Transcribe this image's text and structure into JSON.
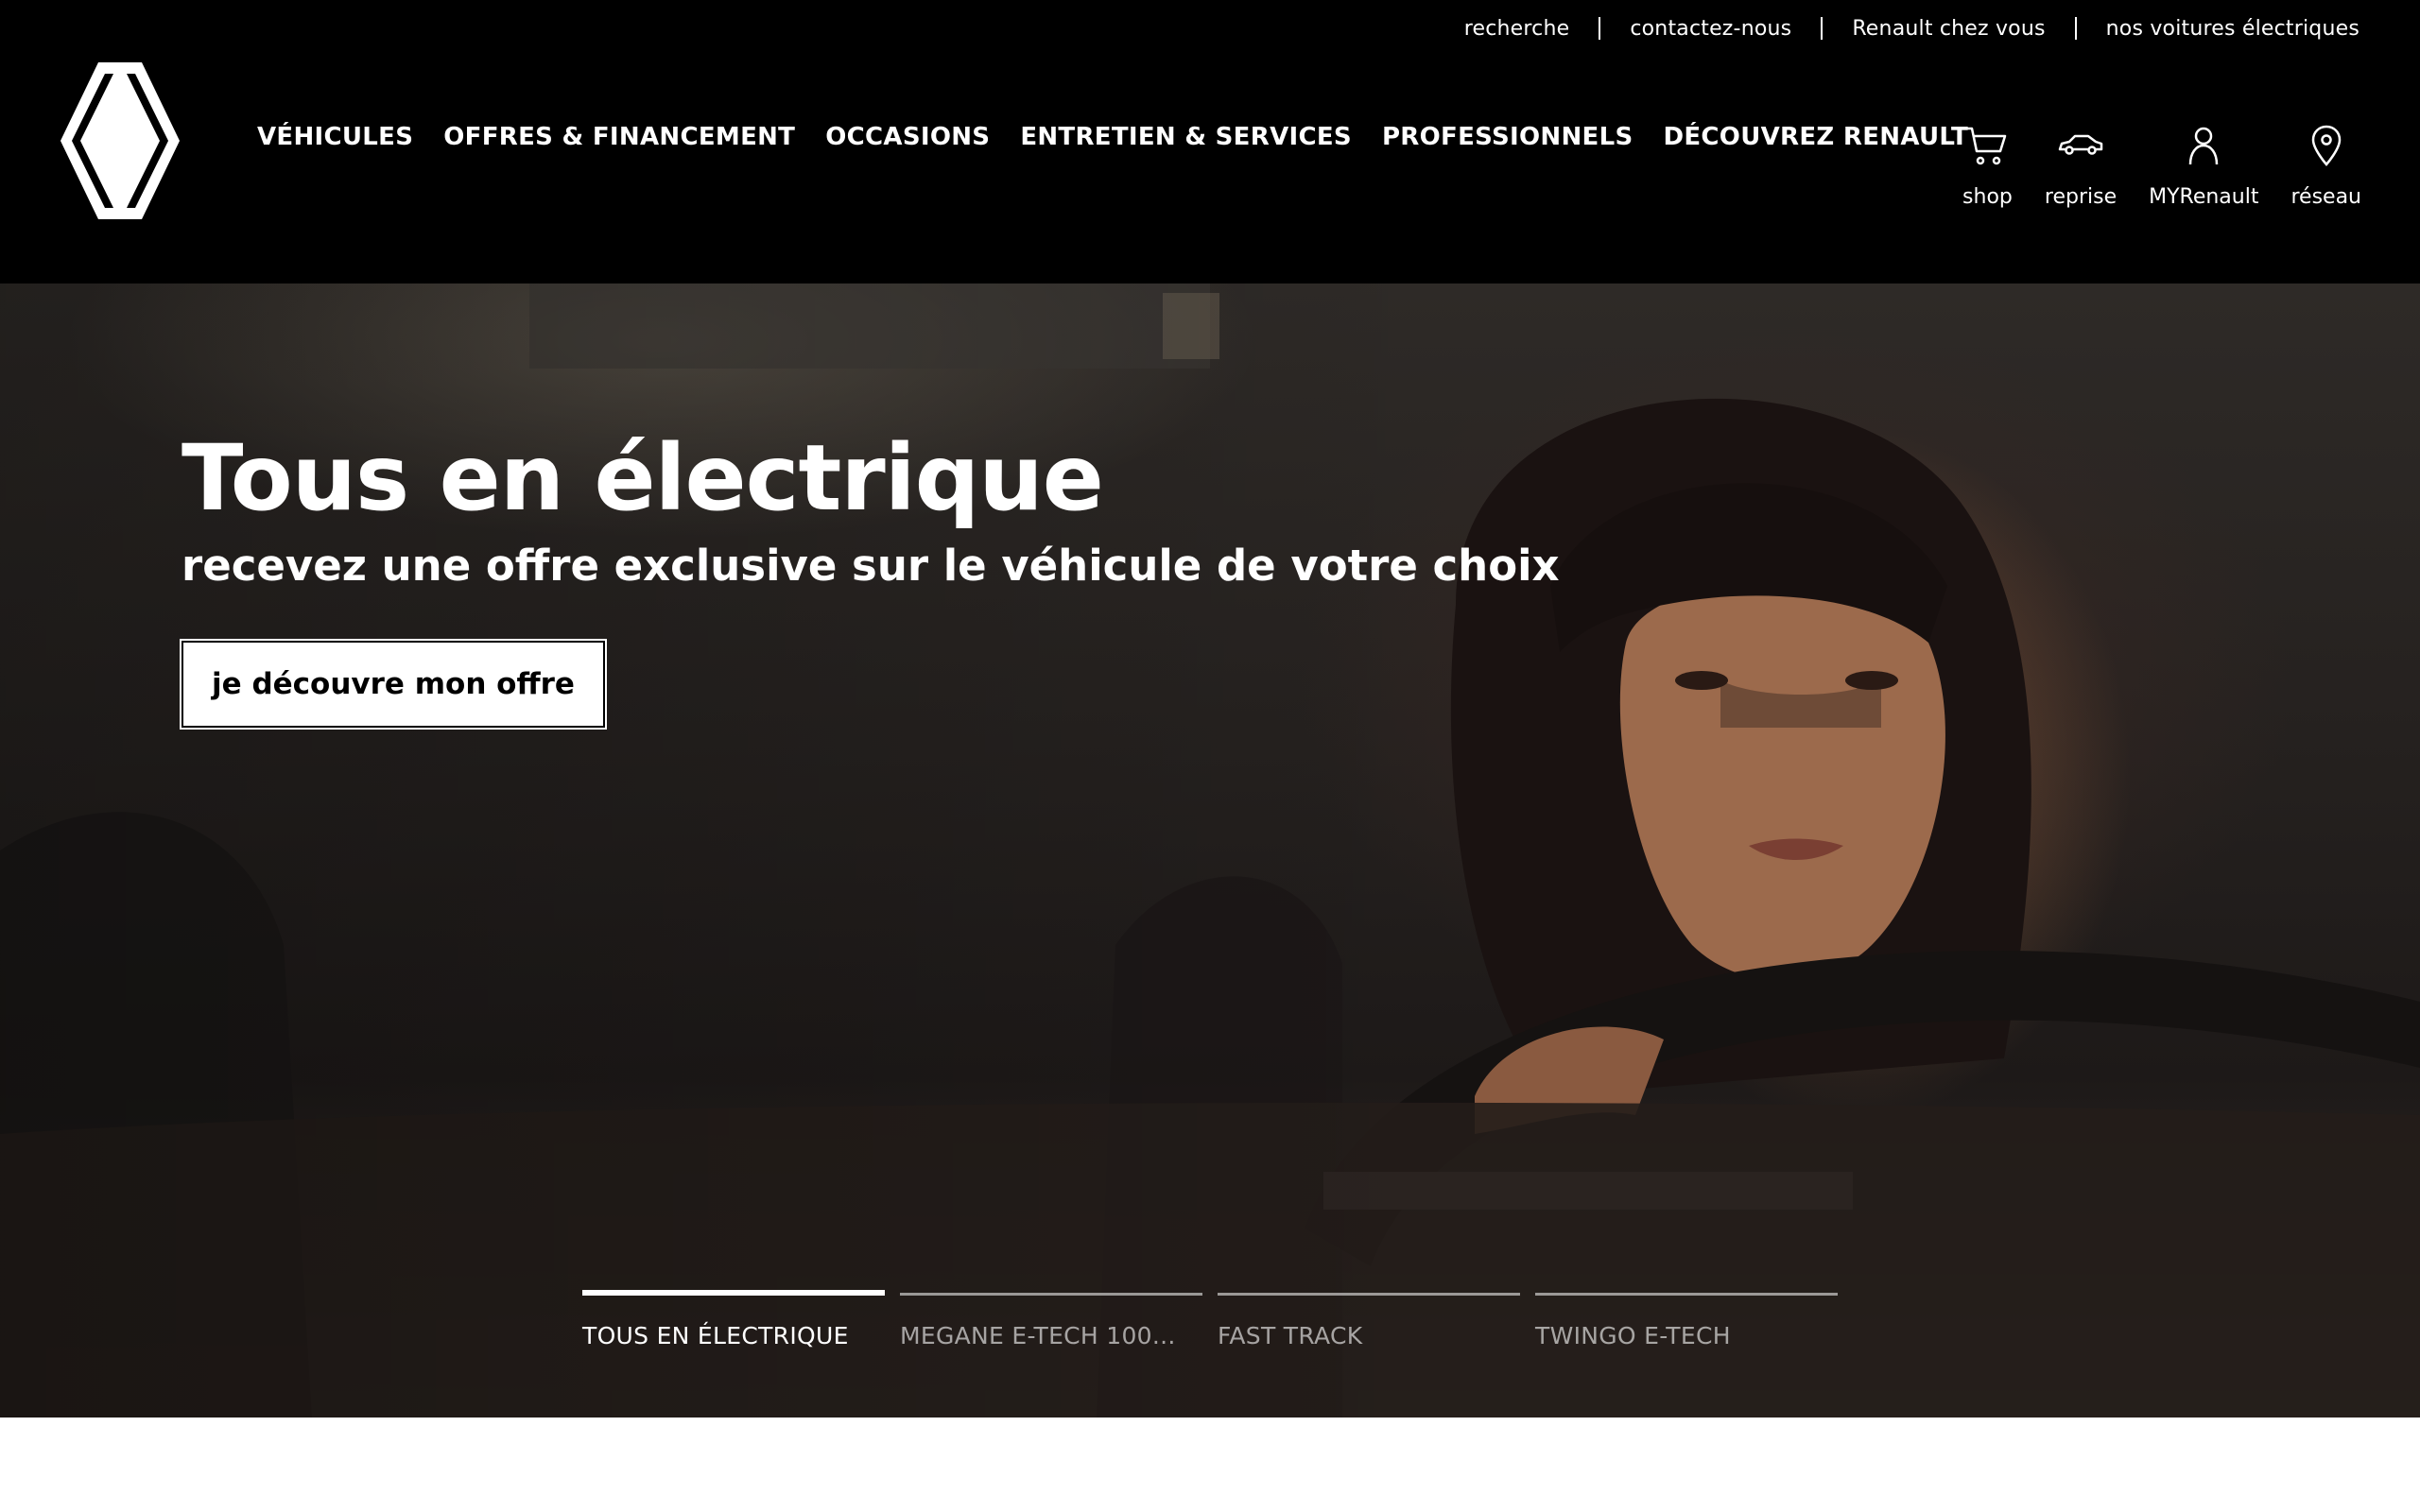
{
  "utility_nav": [
    "recherche",
    "contactez-nous",
    "Renault chez vous",
    "nos voitures électriques"
  ],
  "main_nav": [
    "VÉHICULES",
    "OFFRES & FINANCEMENT",
    "OCCASIONS",
    "ENTRETIEN & SERVICES",
    "PROFESSIONNELS",
    "DÉCOUVREZ RENAULT"
  ],
  "header_icons": [
    {
      "label": "shop",
      "icon": "cart-icon"
    },
    {
      "label": "reprise",
      "icon": "car-icon"
    },
    {
      "label": "MYRenault",
      "icon": "user-icon"
    },
    {
      "label": "réseau",
      "icon": "location-pin-icon"
    }
  ],
  "hero": {
    "title": "Tous en électrique",
    "subtitle": "recevez une offre exclusive sur le véhicule de votre choix",
    "cta": "je découvre mon offre"
  },
  "carousel_tabs": [
    {
      "label": "TOUS EN ÉLECTRIQUE",
      "active": true
    },
    {
      "label": "MEGANE E-TECH 100...",
      "active": false
    },
    {
      "label": "FAST TRACK",
      "active": false
    },
    {
      "label": "TWINGO E-TECH",
      "active": false
    }
  ],
  "colors": {
    "header_bg": "#000000",
    "text": "#ffffff",
    "cta_bg": "#ffffff"
  }
}
